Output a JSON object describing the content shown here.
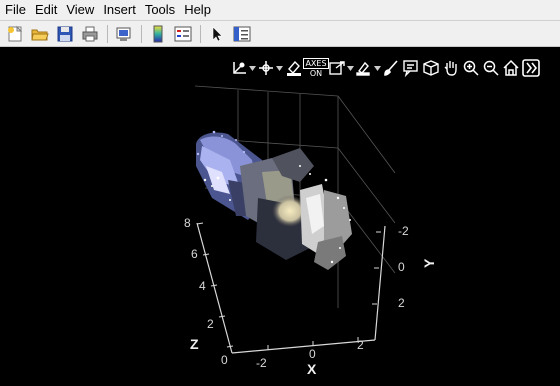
{
  "menu": [
    "File",
    "Edit",
    "View",
    "Insert",
    "Tools",
    "Help"
  ],
  "toolbar": [
    "new-figure-icon",
    "open-file-icon",
    "save-icon",
    "print-icon",
    "print-preview-icon",
    "colorbar-icon",
    "legend-icon",
    "select-pointer-icon",
    "property-inspector-icon"
  ],
  "axes_toolbar": {
    "axes_on_label": [
      "AXES",
      "ON"
    ],
    "icons": [
      "data-tips-icon",
      "rotate-icon",
      "brush-icon",
      "axes-on-icon",
      "export-icon",
      "edit-plot-icon",
      "paintbrush-icon",
      "insert-text-icon",
      "restore-view-box-icon",
      "pan-icon",
      "zoom-in-icon",
      "zoom-out-icon",
      "home-icon",
      "more-icon"
    ]
  },
  "colors": {
    "axes_toolbar_bg": "#000000",
    "plot_bg": "#000000",
    "chrome": "#f0f0f0",
    "cloud_blue": "#8a93d8",
    "cloud_light": "#e8e4d0"
  },
  "axes": {
    "x_label": "X",
    "y_label": "Y",
    "z_label": "Z",
    "x_ticks": [
      "-2",
      "0",
      "2"
    ],
    "y_ticks": [
      "-2",
      "0",
      "2"
    ],
    "z_ticks": [
      "0",
      "2",
      "4",
      "6",
      "8"
    ]
  }
}
